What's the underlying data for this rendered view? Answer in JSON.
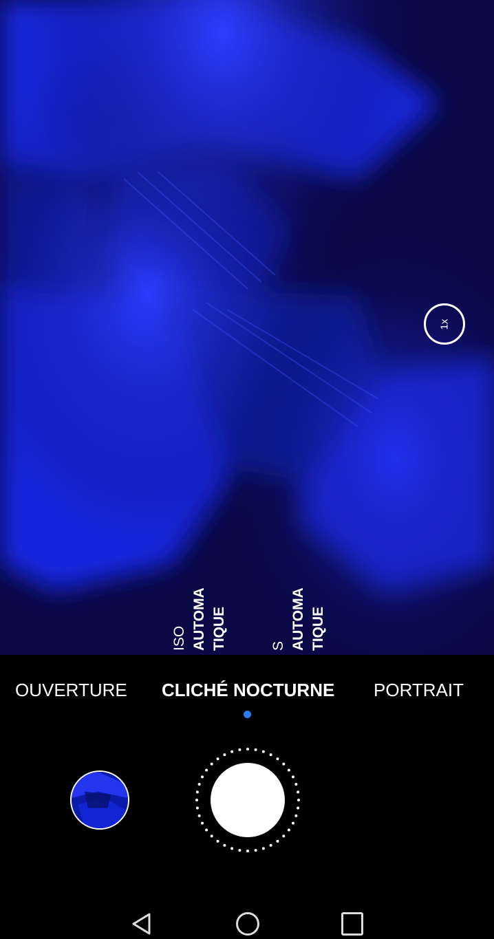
{
  "viewfinder": {
    "zoom_label": "1x",
    "params": [
      {
        "label": "ISO",
        "value_line1": "AUTOMA",
        "value_line2": "TIQUE"
      },
      {
        "label": "S",
        "value_line1": "AUTOMA",
        "value_line2": "TIQUE"
      }
    ]
  },
  "modes": {
    "left": "OUVERTURE",
    "center": "CLICHÉ NOCTURNE",
    "right": "PORTRAIT"
  },
  "colors": {
    "accent": "#2d7cf0",
    "viewfinder_tint": "#1a1aff"
  },
  "icons": {
    "gallery": "gallery-thumbnail",
    "back": "back-icon",
    "home": "home-icon",
    "recents": "recents-icon"
  }
}
